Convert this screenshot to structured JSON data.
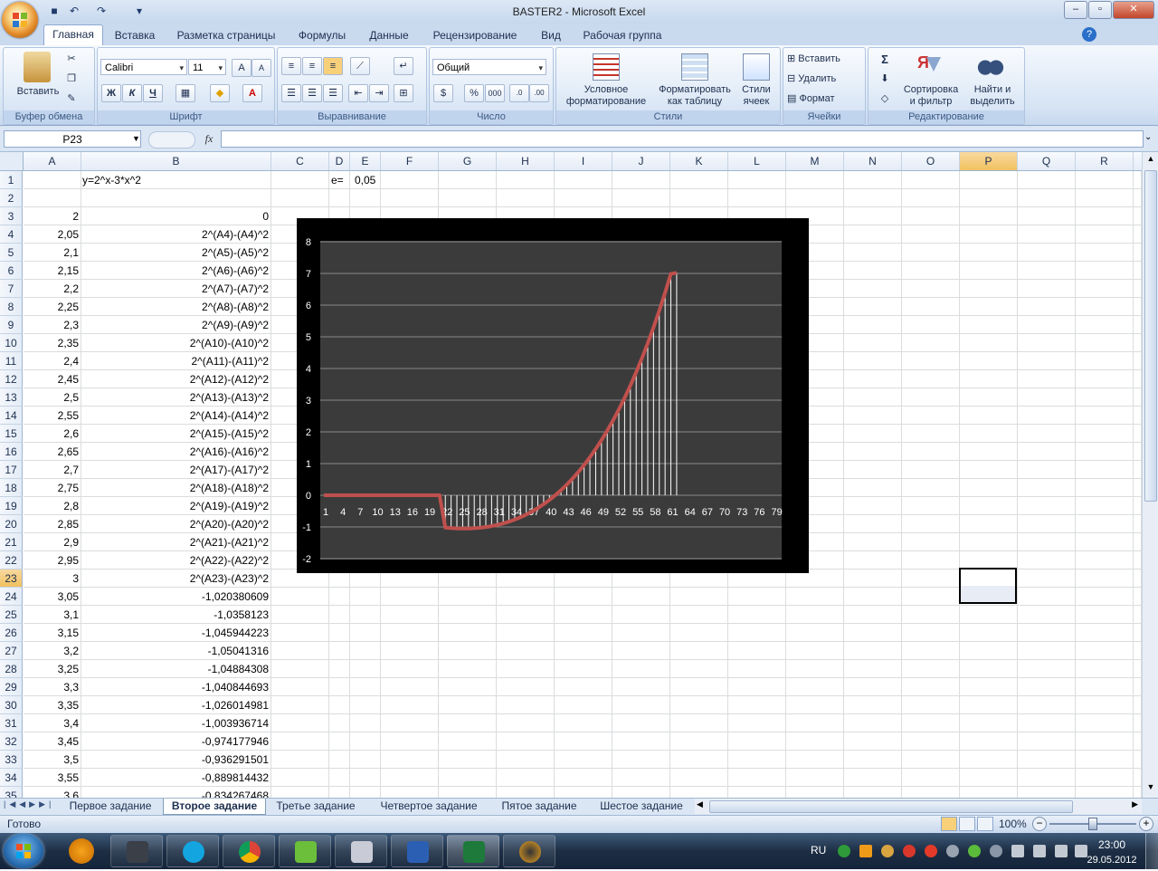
{
  "window": {
    "title": "BASTER2 - Microsoft Excel"
  },
  "ribbon_tabs": [
    "Главная",
    "Вставка",
    "Разметка страницы",
    "Формулы",
    "Данные",
    "Рецензирование",
    "Вид",
    "Рабочая группа"
  ],
  "ribbon": {
    "clipboard": {
      "label": "Буфер обмена",
      "paste": "Вставить"
    },
    "font": {
      "label": "Шрифт",
      "family": "Calibri",
      "size": "11",
      "bold": "Ж",
      "italic": "К",
      "underline": "Ч"
    },
    "alignment": {
      "label": "Выравнивание"
    },
    "number": {
      "label": "Число",
      "format": "Общий",
      "percent": "%",
      "thousands": "000"
    },
    "styles": {
      "label": "Стили",
      "conditional": "Условное форматирование",
      "as_table": "Форматировать как таблицу",
      "cell_styles": "Стили ячеек"
    },
    "cells": {
      "label": "Ячейки",
      "insert": "Вставить",
      "delete": "Удалить",
      "format": "Формат"
    },
    "editing": {
      "label": "Редактирование",
      "sort": "Сортировка и фильтр",
      "find": "Найти и выделить",
      "sum": "Σ"
    }
  },
  "formula_bar": {
    "name_box": "P23",
    "fx": "fx",
    "content": ""
  },
  "columns": [
    "A",
    "B",
    "C",
    "D",
    "E",
    "F",
    "G",
    "H",
    "I",
    "J",
    "K",
    "L",
    "M",
    "N",
    "O",
    "P",
    "Q",
    "R"
  ],
  "top_cells": {
    "b1": "y=2^x-3*x^2",
    "d1": "e=",
    "e1": "0,05"
  },
  "rows": [
    {
      "n": "1",
      "a": "",
      "b": ""
    },
    {
      "n": "2",
      "a": "",
      "b": ""
    },
    {
      "n": "3",
      "a": "2",
      "b": "0"
    },
    {
      "n": "4",
      "a": "2,05",
      "b": "2^(A4)-(A4)^2"
    },
    {
      "n": "5",
      "a": "2,1",
      "b": "2^(A5)-(A5)^2"
    },
    {
      "n": "6",
      "a": "2,15",
      "b": "2^(A6)-(A6)^2"
    },
    {
      "n": "7",
      "a": "2,2",
      "b": "2^(A7)-(A7)^2"
    },
    {
      "n": "8",
      "a": "2,25",
      "b": "2^(A8)-(A8)^2"
    },
    {
      "n": "9",
      "a": "2,3",
      "b": "2^(A9)-(A9)^2"
    },
    {
      "n": "10",
      "a": "2,35",
      "b": "2^(A10)-(A10)^2"
    },
    {
      "n": "11",
      "a": "2,4",
      "b": "2^(A11)-(A11)^2"
    },
    {
      "n": "12",
      "a": "2,45",
      "b": "2^(A12)-(A12)^2"
    },
    {
      "n": "13",
      "a": "2,5",
      "b": "2^(A13)-(A13)^2"
    },
    {
      "n": "14",
      "a": "2,55",
      "b": "2^(A14)-(A14)^2"
    },
    {
      "n": "15",
      "a": "2,6",
      "b": "2^(A15)-(A15)^2"
    },
    {
      "n": "16",
      "a": "2,65",
      "b": "2^(A16)-(A16)^2"
    },
    {
      "n": "17",
      "a": "2,7",
      "b": "2^(A17)-(A17)^2"
    },
    {
      "n": "18",
      "a": "2,75",
      "b": "2^(A18)-(A18)^2"
    },
    {
      "n": "19",
      "a": "2,8",
      "b": "2^(A19)-(A19)^2"
    },
    {
      "n": "20",
      "a": "2,85",
      "b": "2^(A20)-(A20)^2"
    },
    {
      "n": "21",
      "a": "2,9",
      "b": "2^(A21)-(A21)^2"
    },
    {
      "n": "22",
      "a": "2,95",
      "b": "2^(A22)-(A22)^2"
    },
    {
      "n": "23",
      "a": "3",
      "b": "2^(A23)-(A23)^2"
    },
    {
      "n": "24",
      "a": "3,05",
      "b": "-1,020380609"
    },
    {
      "n": "25",
      "a": "3,1",
      "b": "-1,0358123"
    },
    {
      "n": "26",
      "a": "3,15",
      "b": "-1,045944223"
    },
    {
      "n": "27",
      "a": "3,2",
      "b": "-1,05041316"
    },
    {
      "n": "28",
      "a": "3,25",
      "b": "-1,04884308"
    },
    {
      "n": "29",
      "a": "3,3",
      "b": "-1,040844693"
    },
    {
      "n": "30",
      "a": "3,35",
      "b": "-1,026014981"
    },
    {
      "n": "31",
      "a": "3,4",
      "b": "-1,003936714"
    },
    {
      "n": "32",
      "a": "3,45",
      "b": "-0,974177946"
    },
    {
      "n": "33",
      "a": "3,5",
      "b": "-0,936291501"
    },
    {
      "n": "34",
      "a": "3,55",
      "b": "-0,889814432"
    },
    {
      "n": "35",
      "a": "3,6",
      "b": "-0,834267468"
    }
  ],
  "chart_data": {
    "type": "line",
    "categories": [
      "1",
      "4",
      "7",
      "10",
      "13",
      "16",
      "19",
      "22",
      "25",
      "28",
      "31",
      "34",
      "37",
      "40",
      "43",
      "46",
      "49",
      "52",
      "55",
      "58",
      "61",
      "64",
      "67",
      "70",
      "73",
      "76",
      "79"
    ],
    "ylim": [
      -2,
      8
    ],
    "yticks": [
      "8",
      "7",
      "6",
      "5",
      "4",
      "3",
      "2",
      "1",
      "0",
      "-1",
      "-2"
    ],
    "grid": true,
    "series_color": "#c0504d",
    "droplines": true,
    "x_start_values": 21,
    "series": [
      {
        "values": [
          0,
          0,
          0,
          0,
          0,
          0,
          0,
          0,
          0,
          0,
          0,
          0,
          0,
          0,
          0,
          0,
          0,
          0,
          0,
          0,
          0,
          -1.0204,
          -1.0358,
          -1.0459,
          -1.0504,
          -1.0488,
          -1.0408,
          -1.026,
          -1.0039,
          -0.9742,
          -0.9363,
          -0.8898,
          -0.8343,
          -0.7691,
          -0.6939,
          -0.6081,
          -0.5112,
          -0.4027,
          -0.282,
          -0.1485,
          -0.0017,
          0.159,
          0.335,
          0.526,
          0.733,
          0.957,
          1.199,
          1.459,
          1.739,
          2.039,
          2.36,
          2.704,
          3.071,
          3.463,
          3.881,
          4.325,
          4.797,
          5.298,
          5.829,
          6.392,
          6.988,
          7.02
        ]
      }
    ]
  },
  "sheet_tabs": [
    "Первое задание",
    "Второе задание",
    "Третье задание",
    "Четвертое задание",
    "Пятое задание",
    "Шестое задание"
  ],
  "active_sheet": "Второе задание",
  "status": {
    "ready": "Готово",
    "zoom": "100%"
  },
  "taskbar": {
    "lang": "RU",
    "time": "23:00",
    "date": "29.05.2012"
  }
}
